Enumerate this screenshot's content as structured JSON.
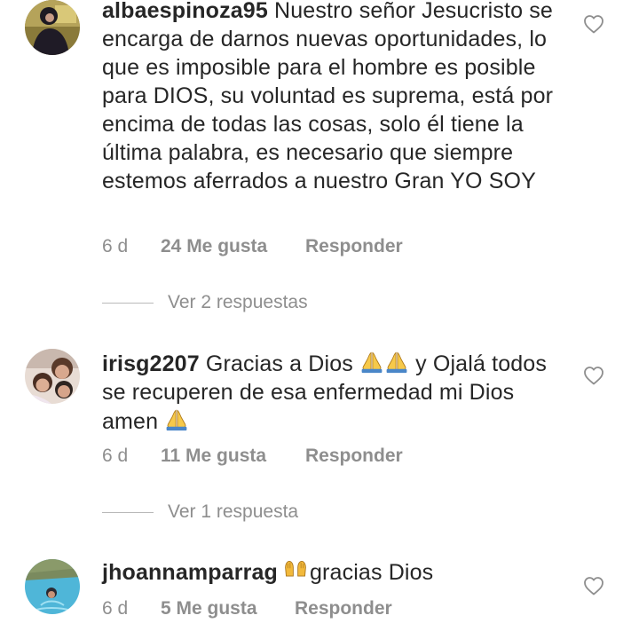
{
  "comments": [
    {
      "username": "albaespinoza95",
      "text": "Nuestro señor Jesucristo se encarga de darnos nuevas oportunidades, lo que es imposible para el hombre es posible para DIOS, su voluntad es suprema, está por encima de todas las cosas, solo él tiene la última palabra, es necesario que siempre estemos aferrados a nuestro Gran YO SOY",
      "time": "6 d",
      "likes": "24 Me gusta",
      "reply": "Responder",
      "view_replies": "Ver 2 respuestas"
    },
    {
      "username": "irisg2207",
      "text_before": "Gracias a Dios",
      "text_after": "y Ojalá todos se recuperen de esa enfermedad mi Dios amen",
      "emoji_icon": "folded-hands-emoji",
      "time": "6 d",
      "likes": "11 Me gusta",
      "reply": "Responder",
      "view_replies": "Ver 1 respuesta"
    },
    {
      "username": "jhoannamparrag",
      "text": "gracias Dios",
      "emoji_icon": "raising-hands-emoji",
      "time": "6 d",
      "likes": "5 Me gusta",
      "reply": "Responder"
    }
  ],
  "colors": {
    "text": "#262626",
    "secondary": "#8e8e8e",
    "divider": "#b9b9b9"
  },
  "icons": {
    "like": "heart-outline-icon"
  }
}
